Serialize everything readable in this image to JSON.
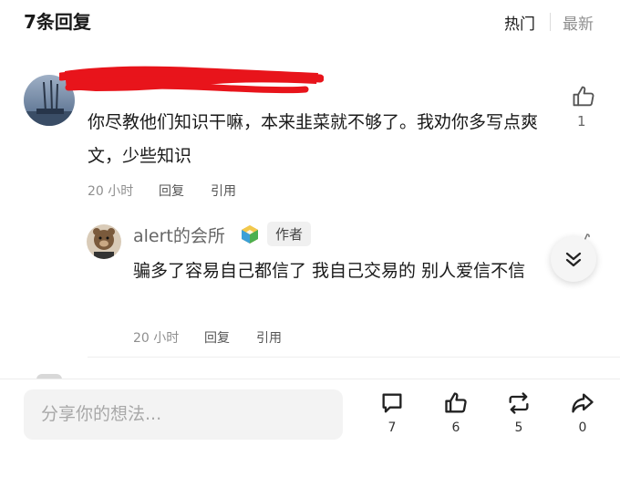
{
  "header": {
    "title": "7条回复",
    "sort_hot": "热门",
    "sort_new": "最新"
  },
  "comments": [
    {
      "text": "你尽教他们知识干嘛，本来韭菜就不够了。我劝你多写点爽文，少些知识",
      "time": "20 小时",
      "reply_label": "回复",
      "quote_label": "引用",
      "likes": "1"
    },
    {
      "username": "alert的会所",
      "badge": "作者",
      "text": "骗多了容易自己都信了 我自己交易的 别人爱信不信",
      "time": "20 小时",
      "reply_label": "回复",
      "quote_label": "引用"
    }
  ],
  "footer": {
    "input_placeholder": "分享你的想法...",
    "comment_count": "7",
    "like_count": "6",
    "repost_count": "5",
    "share_count": "0"
  },
  "icons": [
    "thumb-up-icon",
    "cube-icon",
    "double-chevron-down-icon",
    "comment-icon",
    "repost-icon",
    "share-icon"
  ],
  "colors": {
    "redaction": "#e8141b",
    "muted_text": "#8f8f8f",
    "input_bg": "#f3f3f3"
  }
}
